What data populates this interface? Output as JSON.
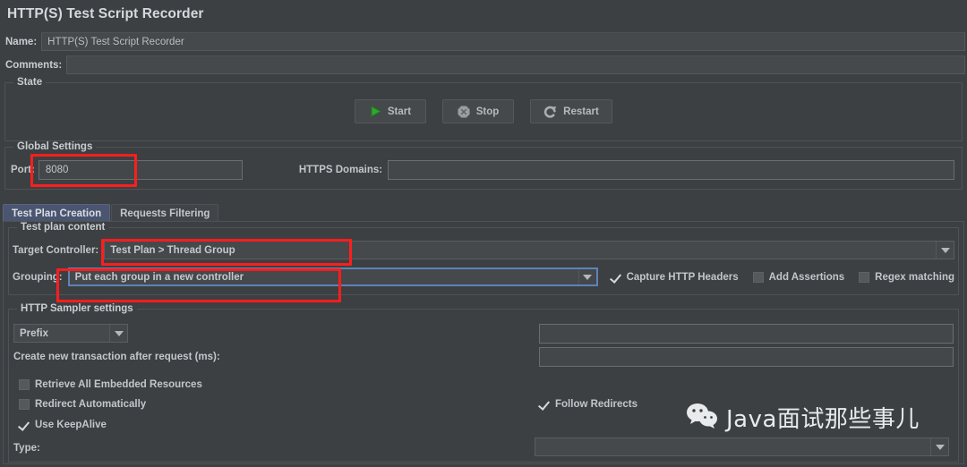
{
  "window": {
    "title": "HTTP(S) Test Script Recorder"
  },
  "fields": {
    "name_label": "Name:",
    "name_value": "HTTP(S) Test Script Recorder",
    "comments_label": "Comments:",
    "comments_value": ""
  },
  "state_panel": {
    "legend": "State",
    "buttons": [
      {
        "label": "Start",
        "icon": "play-icon"
      },
      {
        "label": "Stop",
        "icon": "stop-octagon-icon"
      },
      {
        "label": "Restart",
        "icon": "restart-arrow-icon"
      }
    ]
  },
  "global_settings": {
    "legend": "Global Settings",
    "port_label": "Port:",
    "port_value": "8080",
    "https_domains_label": "HTTPS Domains:",
    "https_domains_value": ""
  },
  "tabs": [
    {
      "label": "Test Plan Creation",
      "active": true
    },
    {
      "label": "Requests Filtering",
      "active": false
    }
  ],
  "test_plan_content": {
    "legend": "Test plan content",
    "target_controller_label": "Target Controller:",
    "target_controller_value": "Test Plan > Thread Group",
    "grouping_label": "Grouping:",
    "grouping_value": "Put each group in a new controller",
    "checkboxes": [
      {
        "label": "Capture HTTP Headers",
        "checked": true
      },
      {
        "label": "Add Assertions",
        "checked": false
      },
      {
        "label": "Regex matching",
        "checked": false
      }
    ]
  },
  "http_sampler_settings": {
    "legend": "HTTP Sampler settings",
    "prefix_value": "Prefix",
    "prefix_field_value": "",
    "transaction_label": "Create new transaction after request (ms):",
    "transaction_value": "",
    "retrieve_embedded": {
      "label": "Retrieve All Embedded Resources",
      "checked": false
    },
    "redirect_automatically": {
      "label": "Redirect Automatically",
      "checked": false
    },
    "follow_redirects": {
      "label": "Follow Redirects",
      "checked": true
    },
    "use_keepalive": {
      "label": "Use KeepAlive",
      "checked": true
    },
    "type_label": "Type:",
    "type_value": ""
  },
  "watermark": {
    "text": "Java面试那些事儿",
    "icon": "wechat-icon"
  },
  "colors": {
    "background": "#3c4043",
    "field": "#45494c",
    "accent_tab": "#4a5570",
    "annotation": "#ff1d1d",
    "start_green": "#2fa82f",
    "focus_blue": "#5f82b8"
  }
}
